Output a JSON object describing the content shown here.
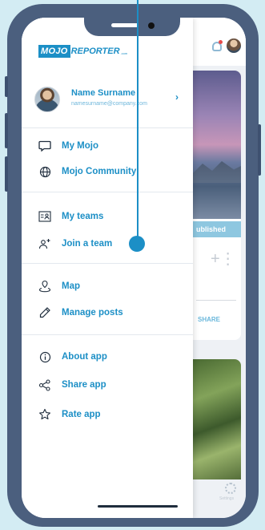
{
  "logo": {
    "mojo": "MOJO",
    "reporter": "REPORTER",
    "com": ".com"
  },
  "profile": {
    "name": "Name Surname",
    "email": "namesurname@company.com",
    "chevron": "›"
  },
  "menu": {
    "section1": [
      {
        "label": "My Mojo",
        "icon": "chat-bubble-icon"
      },
      {
        "label": "Mojo Community",
        "icon": "globe-icon"
      }
    ],
    "section2": [
      {
        "label": "My teams",
        "icon": "teams-icon"
      },
      {
        "label": "Join a team",
        "icon": "add-user-icon"
      }
    ],
    "section3": [
      {
        "label": "Map",
        "icon": "map-pin-icon"
      },
      {
        "label": "Manage posts",
        "icon": "pencil-icon"
      }
    ],
    "section4": [
      {
        "label": "About app",
        "icon": "info-icon"
      },
      {
        "label": "Share app",
        "icon": "share-icon"
      },
      {
        "label": "Rate app",
        "icon": "star-icon"
      }
    ]
  },
  "background": {
    "status": "ublished",
    "share": "SHARE",
    "settings": "Settings"
  },
  "colors": {
    "accent": "#1c8fc6",
    "frame": "#4b5f7e",
    "backdrop": "#d3ecf3"
  }
}
